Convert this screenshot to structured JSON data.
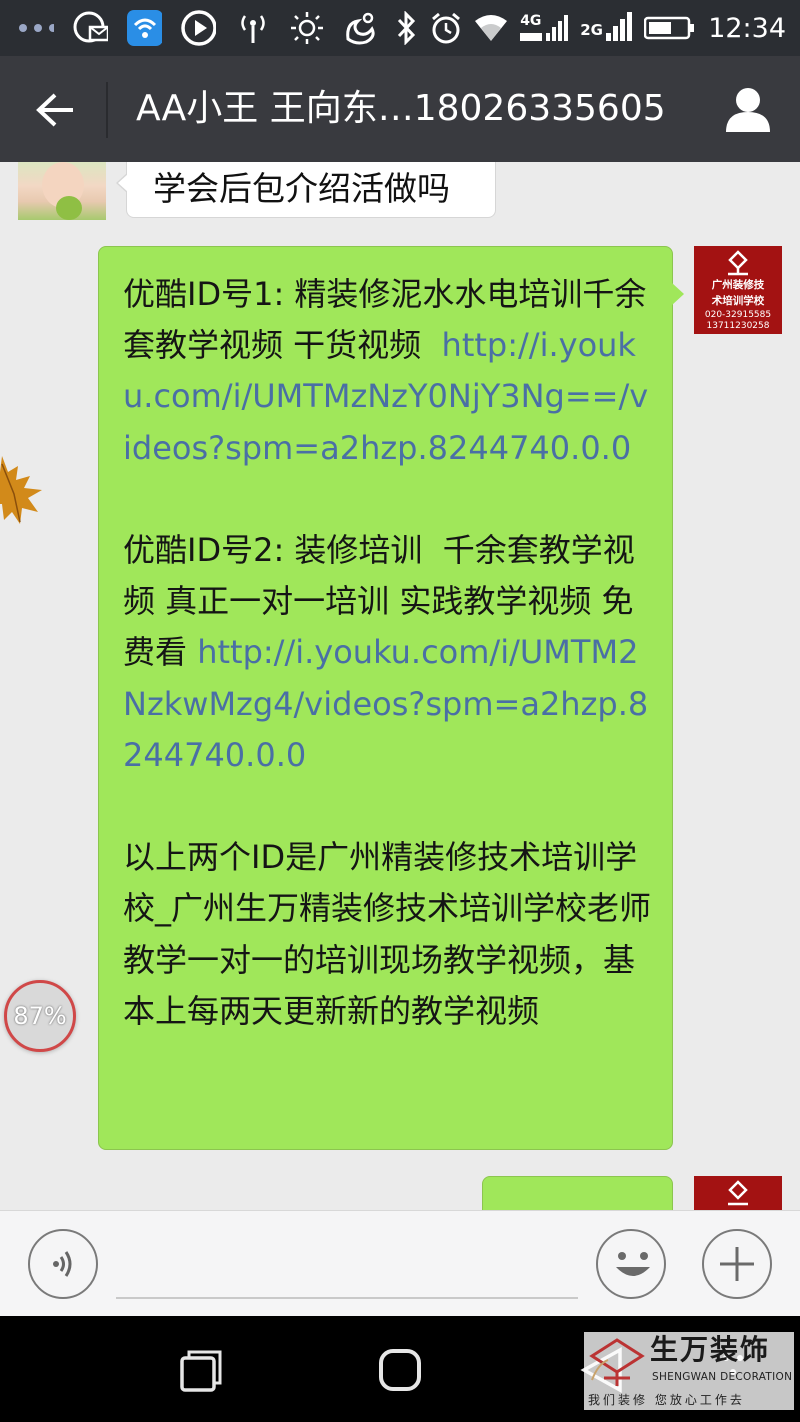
{
  "status_bar": {
    "time": "12:34",
    "network_label_1": "4G",
    "network_label_2": "2G",
    "icons": [
      "more-dots-icon",
      "mail-icon",
      "wifi-hotspot-icon",
      "play-icon",
      "signal-tower-icon",
      "brightness-icon",
      "uc-browser-icon",
      "bluetooth-icon",
      "alarm-icon",
      "wifi-icon",
      "cell-signal-icon",
      "battery-icon"
    ]
  },
  "header": {
    "title": "AA小王 王向东…18026335605",
    "back_icon": "back-arrow-icon",
    "profile_icon": "person-icon"
  },
  "messages": {
    "incoming_1": "学会后包介绍活做吗",
    "outgoing_1": {
      "p1_text": "优酷ID号1: 精装修泥水水电培训千余套教学视频 干货视频  ",
      "p1_link": "http://i.youku.com/i/UMTMzNzY0NjY3Ng==/videos?spm=a2hzp.8244740.0.0",
      "p2_text": "优酷ID号2: 装修培训  千余套教学视频 真正一对一培训 实践教学视频 免费看 ",
      "p2_link": "http://i.youku.com/i/UMTM2NzkwMzg4/videos?spm=a2hzp.8244740.0.0",
      "p3_text": "以上两个ID是广州精装修技术培训学校_广州生万精装修技术培训学校老师教学一对一的培训现场教学视频，基本上每两天更新新的教学视频"
    }
  },
  "avatar_right": {
    "line1": "广州装修技",
    "line2": "术培训学校",
    "line3": "020-32915585",
    "line4": "13711230258"
  },
  "float_badge": "87%",
  "input_bar": {
    "voice_icon": "voice-icon",
    "emoji_icon": "smiley-icon",
    "plus_icon": "plus-icon"
  },
  "watermark": {
    "name": "生万装饰",
    "english": "SHENGWAN DECORATION",
    "slogan": "我们装修 您放心工作去"
  },
  "colors": {
    "status_bar": "#2b2e33",
    "title_bar": "#393a3f",
    "chat_bg": "#ebebeb",
    "outgoing_bubble": "#a0e75a",
    "link": "#4a6fa5",
    "brand_red": "#a31212"
  }
}
